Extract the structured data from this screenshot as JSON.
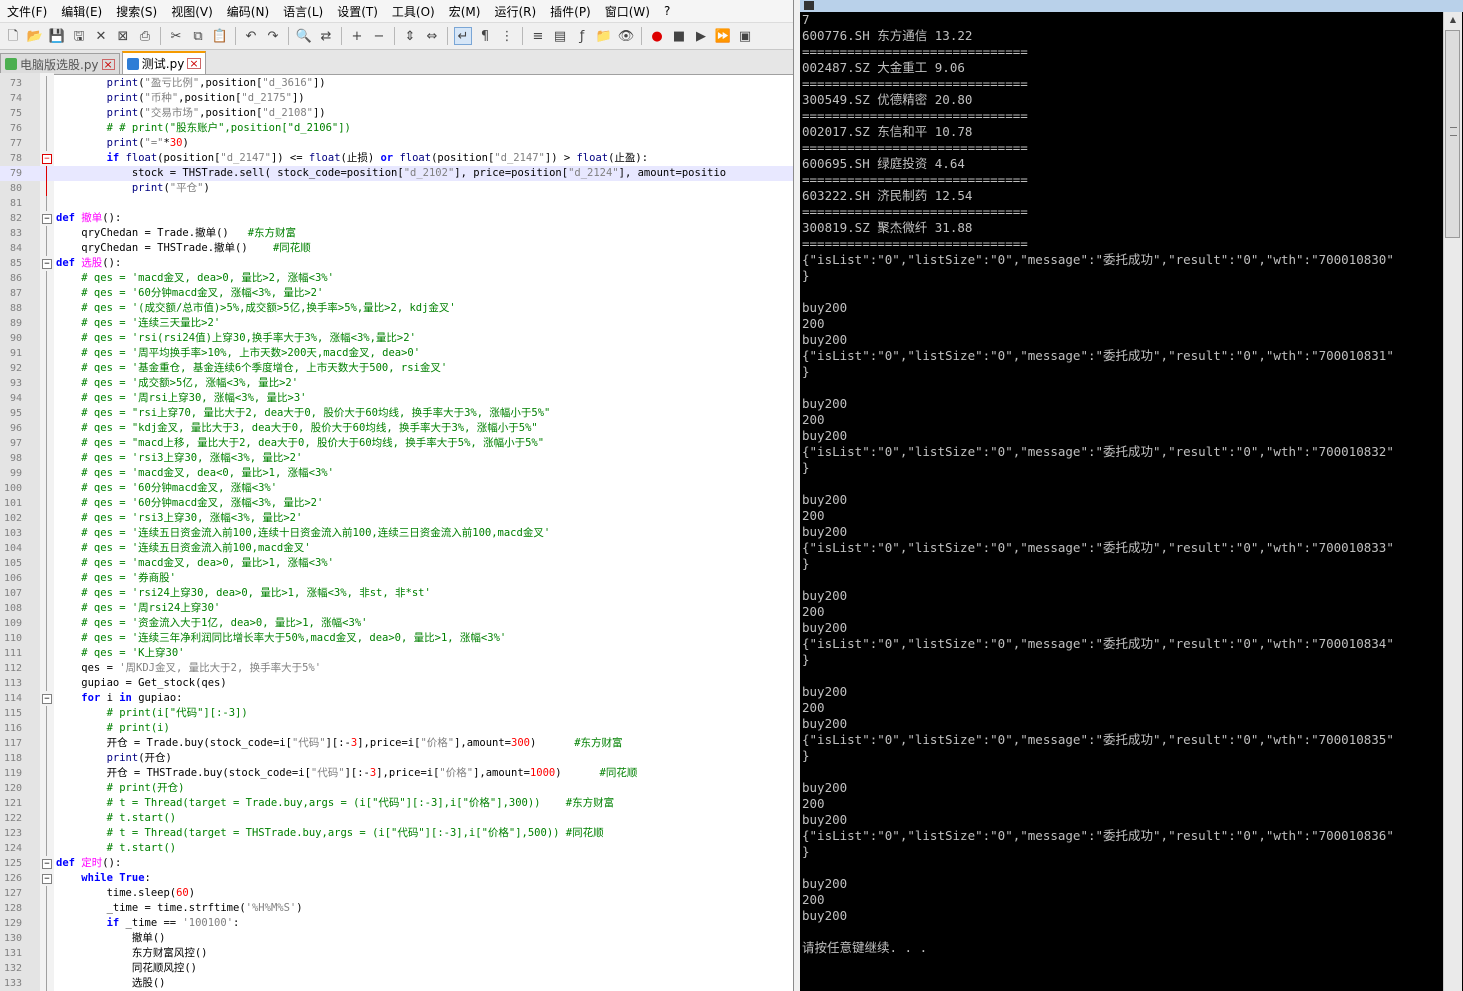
{
  "menu": [
    "文件(F)",
    "编辑(E)",
    "搜索(S)",
    "视图(V)",
    "编码(N)",
    "语言(L)",
    "设置(T)",
    "工具(O)",
    "宏(M)",
    "运行(R)",
    "插件(P)",
    "窗口(W)",
    "?"
  ],
  "tabs": [
    {
      "label": "电脑版选股.py",
      "active": false
    },
    {
      "label": "测试.py",
      "active": true
    }
  ],
  "code_lines": [
    {
      "n": "73",
      "t": "        print(\"盈亏比例\",position[\"d_3616\"])"
    },
    {
      "n": "74",
      "t": "        print(\"币种\",position[\"d_2175\"])"
    },
    {
      "n": "75",
      "t": "        print(\"交易市场\",position[\"d_2108\"])"
    },
    {
      "n": "76",
      "t": "        # # print(\"股东账户\",position[\"d_2106\"])"
    },
    {
      "n": "77",
      "t": "        print(\"=\"*30)"
    },
    {
      "n": "78",
      "t": "        if float(position[\"d_2147\"]) <= float(止损) or float(position[\"d_2147\"]) > float(止盈):"
    },
    {
      "n": "79",
      "t": "            stock = THSTrade.sell( stock_code=position[\"d_2102\"], price=position[\"d_2124\"], amount=positio"
    },
    {
      "n": "80",
      "t": "            print(\"平仓\")"
    },
    {
      "n": "81",
      "t": ""
    },
    {
      "n": "82",
      "t": "def 撤单():"
    },
    {
      "n": "83",
      "t": "    qryChedan = Trade.撤单()   #东方财富"
    },
    {
      "n": "84",
      "t": "    qryChedan = THSTrade.撤单()    #同花顺"
    },
    {
      "n": "85",
      "t": "def 选股():"
    },
    {
      "n": "86",
      "t": "    # qes = 'macd金叉, dea>0, 量比>2, 涨幅<3%'"
    },
    {
      "n": "87",
      "t": "    # qes = '60分钟macd金叉, 涨幅<3%, 量比>2'"
    },
    {
      "n": "88",
      "t": "    # qes = '(成交额/总市值)>5%,成交额>5亿,换手率>5%,量比>2, kdj金叉'"
    },
    {
      "n": "89",
      "t": "    # qes = '连续三天量比>2'"
    },
    {
      "n": "90",
      "t": "    # qes = 'rsi(rsi24值)上穿30,换手率大于3%, 涨幅<3%,量比>2'"
    },
    {
      "n": "91",
      "t": "    # qes = '周平均换手率>10%, 上市天数>200天,macd金叉, dea>0'"
    },
    {
      "n": "92",
      "t": "    # qes = '基金重仓, 基金连续6个季度增仓, 上市天数大于500, rsi金叉'"
    },
    {
      "n": "93",
      "t": "    # qes = '成交额>5亿, 涨幅<3%, 量比>2'"
    },
    {
      "n": "94",
      "t": "    # qes = '周rsi上穿30, 涨幅<3%, 量比>3'"
    },
    {
      "n": "95",
      "t": "    # qes = \"rsi上穿70, 量比大于2, dea大于0, 股价大于60均线, 换手率大于3%, 涨幅小于5%\""
    },
    {
      "n": "96",
      "t": "    # qes = \"kdj金叉, 量比大于3, dea大于0, 股价大于60均线, 换手率大于3%, 涨幅小于5%\""
    },
    {
      "n": "97",
      "t": "    # qes = \"macd上移, 量比大于2, dea大于0, 股价大于60均线, 换手率大于5%, 涨幅小于5%\""
    },
    {
      "n": "98",
      "t": "    # qes = 'rsi3上穿30, 涨幅<3%, 量比>2'"
    },
    {
      "n": "99",
      "t": "    # qes = 'macd金叉, dea<0, 量比>1, 涨幅<3%'"
    },
    {
      "n": "100",
      "t": "    # qes = '60分钟macd金叉, 涨幅<3%'"
    },
    {
      "n": "101",
      "t": "    # qes = '60分钟macd金叉, 涨幅<3%, 量比>2'"
    },
    {
      "n": "102",
      "t": "    # qes = 'rsi3上穿30, 涨幅<3%, 量比>2'"
    },
    {
      "n": "103",
      "t": "    # qes = '连续五日资金流入前100,连续十日资金流入前100,连续三日资金流入前100,macd金叉'"
    },
    {
      "n": "104",
      "t": "    # qes = '连续五日资金流入前100,macd金叉'"
    },
    {
      "n": "105",
      "t": "    # qes = 'macd金叉, dea>0, 量比>1, 涨幅<3%'"
    },
    {
      "n": "106",
      "t": "    # qes = '券商股'"
    },
    {
      "n": "107",
      "t": "    # qes = 'rsi24上穿30, dea>0, 量比>1, 涨幅<3%, 非st, 非*st'"
    },
    {
      "n": "108",
      "t": "    # qes = '周rsi24上穿30'"
    },
    {
      "n": "109",
      "t": "    # qes = '资金流入大于1亿, dea>0, 量比>1, 涨幅<3%'"
    },
    {
      "n": "110",
      "t": "    # qes = '连续三年净利润同比增长率大于50%,macd金叉, dea>0, 量比>1, 涨幅<3%'"
    },
    {
      "n": "111",
      "t": "    # qes = 'K上穿30'"
    },
    {
      "n": "112",
      "t": "    qes = '周KDJ金叉, 量比大于2, 换手率大于5%'"
    },
    {
      "n": "113",
      "t": "    gupiao = Get_stock(qes)"
    },
    {
      "n": "114",
      "t": "    for i in gupiao:"
    },
    {
      "n": "115",
      "t": "        # print(i[\"代码\"][:-3])"
    },
    {
      "n": "116",
      "t": "        # print(i)"
    },
    {
      "n": "117",
      "t": "        开仓 = Trade.buy(stock_code=i[\"代码\"][:-3],price=i[\"价格\"],amount=300)      #东方财富"
    },
    {
      "n": "118",
      "t": "        print(开仓)"
    },
    {
      "n": "119",
      "t": "        开仓 = THSTrade.buy(stock_code=i[\"代码\"][:-3],price=i[\"价格\"],amount=1000)      #同花顺"
    },
    {
      "n": "120",
      "t": "        # print(开仓)"
    },
    {
      "n": "121",
      "t": "        # t = Thread(target = Trade.buy,args = (i[\"代码\"][:-3],i[\"价格\"],300))    #东方财富"
    },
    {
      "n": "122",
      "t": "        # t.start()"
    },
    {
      "n": "123",
      "t": "        # t = Thread(target = THSTrade.buy,args = (i[\"代码\"][:-3],i[\"价格\"],500)) #同花顺"
    },
    {
      "n": "124",
      "t": "        # t.start()"
    },
    {
      "n": "125",
      "t": "def 定时():"
    },
    {
      "n": "126",
      "t": "    while True:"
    },
    {
      "n": "127",
      "t": "        time.sleep(60)"
    },
    {
      "n": "128",
      "t": "        _time = time.strftime('%H%M%S')"
    },
    {
      "n": "129",
      "t": "        if _time == '100100':"
    },
    {
      "n": "130",
      "t": "            撤单()"
    },
    {
      "n": "131",
      "t": "            东方财富风控()"
    },
    {
      "n": "132",
      "t": "            同花顺风控()"
    },
    {
      "n": "133",
      "t": "            选股()"
    }
  ],
  "console_lines": [
    "7",
    "600776.SH 东方通信 13.22",
    "==============================",
    "002487.SZ 大金重工 9.06",
    "==============================",
    "300549.SZ 优德精密 20.80",
    "==============================",
    "002017.SZ 东信和平 10.78",
    "==============================",
    "600695.SH 绿庭投资 4.64",
    "==============================",
    "603222.SH 济民制药 12.54",
    "==============================",
    "300819.SZ 聚杰微纤 31.88",
    "==============================",
    "{\"isList\":\"0\",\"listSize\":\"0\",\"message\":\"委托成功\",\"result\":\"0\",\"wth\":\"700010830\"",
    "}",
    "",
    "buy200",
    "200",
    "buy200",
    "{\"isList\":\"0\",\"listSize\":\"0\",\"message\":\"委托成功\",\"result\":\"0\",\"wth\":\"700010831\"",
    "}",
    "",
    "buy200",
    "200",
    "buy200",
    "{\"isList\":\"0\",\"listSize\":\"0\",\"message\":\"委托成功\",\"result\":\"0\",\"wth\":\"700010832\"",
    "}",
    "",
    "buy200",
    "200",
    "buy200",
    "{\"isList\":\"0\",\"listSize\":\"0\",\"message\":\"委托成功\",\"result\":\"0\",\"wth\":\"700010833\"",
    "}",
    "",
    "buy200",
    "200",
    "buy200",
    "{\"isList\":\"0\",\"listSize\":\"0\",\"message\":\"委托成功\",\"result\":\"0\",\"wth\":\"700010834\"",
    "}",
    "",
    "buy200",
    "200",
    "buy200",
    "{\"isList\":\"0\",\"listSize\":\"0\",\"message\":\"委托成功\",\"result\":\"0\",\"wth\":\"700010835\"",
    "}",
    "",
    "buy200",
    "200",
    "buy200",
    "{\"isList\":\"0\",\"listSize\":\"0\",\"message\":\"委托成功\",\"result\":\"0\",\"wth\":\"700010836\"",
    "}",
    "",
    "buy200",
    "200",
    "buy200",
    "",
    "请按任意键继续. . ."
  ],
  "toolbar_icons": [
    "new-file-icon",
    "open-file-icon",
    "save-icon",
    "save-all-icon",
    "close-icon",
    "close-all-icon",
    "print-icon",
    "sep",
    "cut-icon",
    "copy-icon",
    "paste-icon",
    "sep",
    "undo-icon",
    "redo-icon",
    "sep",
    "find-icon",
    "replace-icon",
    "sep",
    "zoom-in-icon",
    "zoom-out-icon",
    "sep",
    "sync-v-icon",
    "sync-h-icon",
    "sep",
    "word-wrap-icon",
    "show-all-chars-icon",
    "indent-guide-icon",
    "sep",
    "udl-icon",
    "doc-map-icon",
    "function-list-icon",
    "folder-workspace-icon",
    "monitoring-icon",
    "sep",
    "record-macro-icon",
    "stop-record-icon",
    "play-macro-icon",
    "run-macro-multiple-icon",
    "save-macro-icon"
  ],
  "colors": {
    "keyword": "#0000ff",
    "comment": "#008000",
    "string": "#808080",
    "defname": "#ff00ff",
    "builtin": "#000080",
    "console_bg": "#000000",
    "console_fg": "#c0c0c0"
  }
}
